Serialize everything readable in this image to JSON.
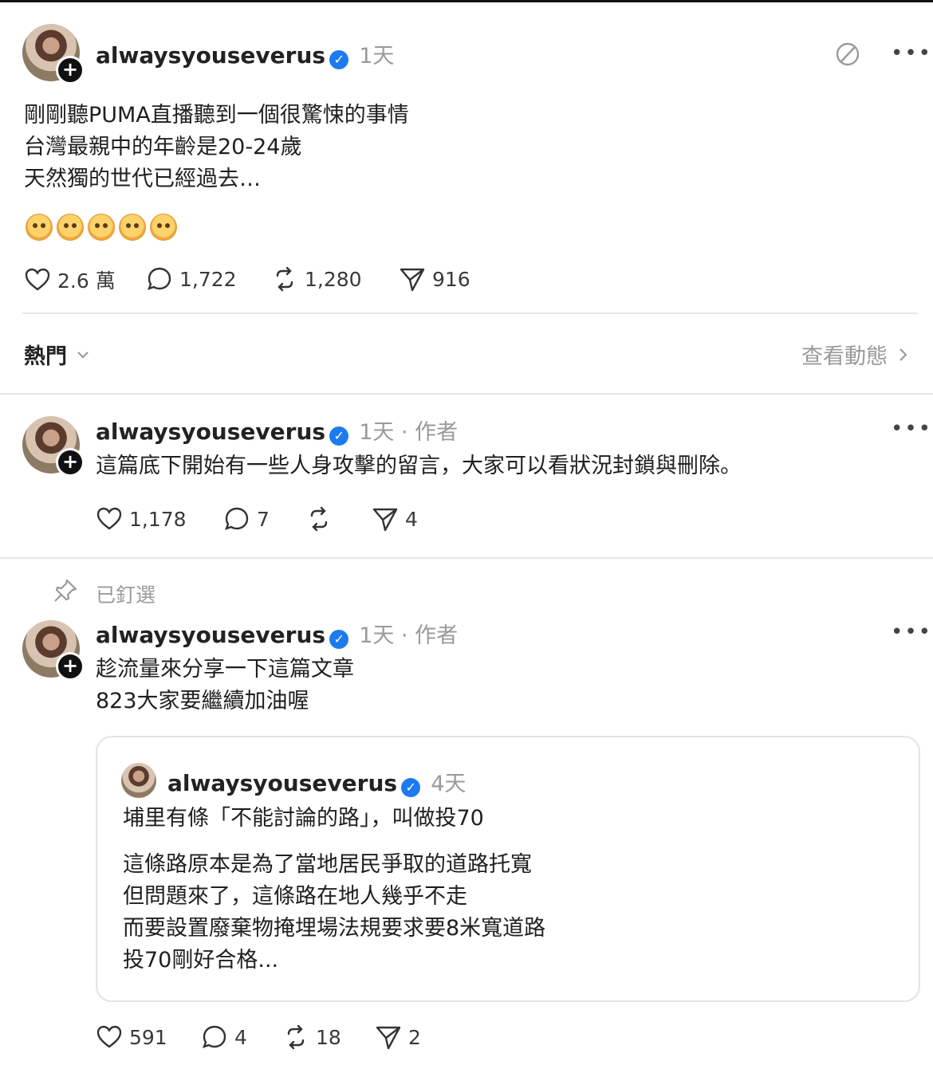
{
  "post": {
    "username": "alwaysyouseverus",
    "time": "1天",
    "lines": [
      "剛剛聽PUMA直播聽到一個很驚悚的事情",
      "台灣最親中的年齡是20-24歲",
      "天然獨的世代已經過去…"
    ],
    "emojis": [
      "flushed-face",
      "flushed-face",
      "flushed-face",
      "flushed-face",
      "flushed-face"
    ],
    "likes": "2.6 萬",
    "comments": "1,722",
    "reposts": "1,280",
    "shares": "916"
  },
  "sort": {
    "label": "熱門",
    "view_activity": "查看動態"
  },
  "reply1": {
    "username": "alwaysyouseverus",
    "meta": "1天 · 作者",
    "text": "這篇底下開始有一些人身攻擊的留言，大家可以看狀況封鎖與刪除。",
    "likes": "1,178",
    "comments": "7",
    "reposts": "",
    "shares": "4"
  },
  "pinned_label": "已釘選",
  "reply2": {
    "username": "alwaysyouseverus",
    "meta": "1天 · 作者",
    "lines": [
      "趁流量來分享一下這篇文章",
      "823大家要繼續加油喔"
    ],
    "likes": "591",
    "comments": "4",
    "reposts": "18",
    "shares": "2"
  },
  "quote": {
    "username": "alwaysyouseverus",
    "time": "4天",
    "first_line": "埔里有條「不能討論的路」，叫做投70",
    "lines": [
      "這條路原本是為了當地居民爭取的道路托寬",
      "但問題來了，這條路在地人幾乎不走",
      "而要設置廢棄物掩埋場法規要求要8米寬道路",
      "投70剛好合格..."
    ]
  },
  "colors": {
    "verified": "#1d7bf0",
    "muted": "#9a9a9a",
    "divider": "#e6e6e6"
  }
}
